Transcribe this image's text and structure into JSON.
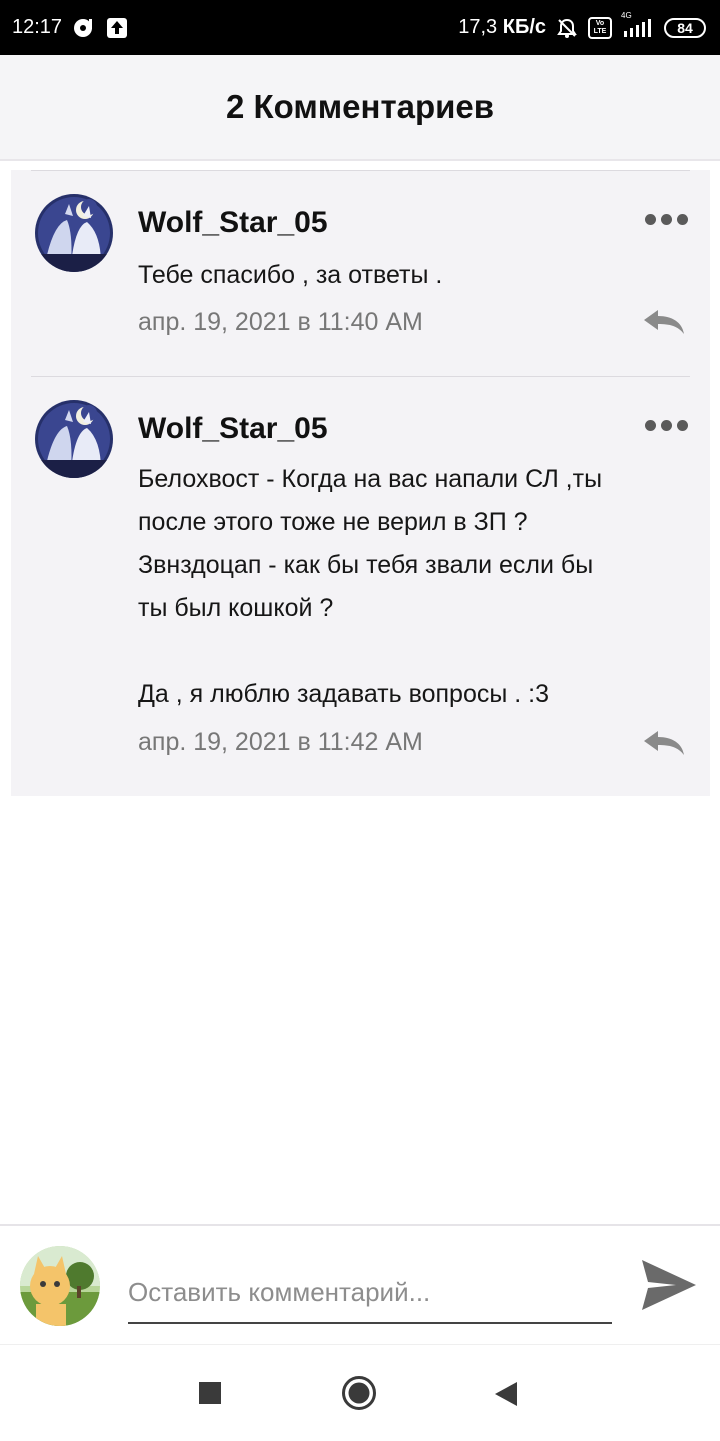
{
  "status_bar": {
    "time": "12:17",
    "speed_value": "17,3",
    "speed_unit": "КБ/с",
    "battery": "84",
    "network": "4G",
    "volte_top": "Vo",
    "volte_bottom": "LTE",
    "icons": [
      "media-icon",
      "upload-icon",
      "bell-off-icon",
      "volte-icon",
      "signal-icon",
      "battery-icon"
    ]
  },
  "header": {
    "title": "2 Комментариев"
  },
  "comments": [
    {
      "author": "Wolf_Star_05",
      "text": "Тебе спасибо , за ответы .",
      "time": "апр. 19, 2021 в 11:40 AM"
    },
    {
      "author": "Wolf_Star_05",
      "text": "Белохвост - Когда на вас напали СЛ ,ты\nпосле этого тоже не верил в ЗП ?\nЗвнздоцап - как бы тебя звали если бы\nты был кошкой ?\n\nДа , я люблю задавать вопросы . :3",
      "time": "апр. 19, 2021 в 11:42 AM"
    }
  ],
  "composer": {
    "placeholder": "Оставить комментарий...",
    "value": ""
  },
  "colors": {
    "header_bg": "#f5f5f7",
    "comment_bg": "#f4f3f6",
    "text": "#161616",
    "muted": "#777777"
  }
}
